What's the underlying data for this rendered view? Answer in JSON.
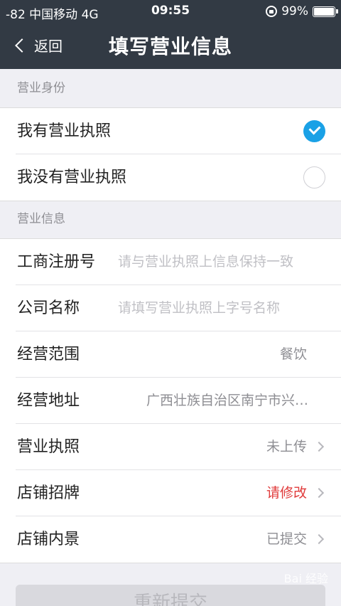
{
  "status_bar": {
    "carrier": "-82 中国移动  4G",
    "time": "09:55",
    "battery": "99%"
  },
  "nav": {
    "back_label": "返回",
    "title": "填写营业信息"
  },
  "identity_section": {
    "header": "营业身份",
    "options": [
      {
        "label": "我有营业执照",
        "selected": true
      },
      {
        "label": "我没有营业执照",
        "selected": false
      }
    ]
  },
  "info_section": {
    "header": "营业信息",
    "rows": [
      {
        "label": "工商注册号",
        "placeholder": "请与营业执照上信息保持一致"
      },
      {
        "label": "公司名称",
        "placeholder": "请填写营业执照上字号名称"
      },
      {
        "label": "经营范围",
        "value": "餐饮"
      },
      {
        "label": "经营地址",
        "value": "广西壮族自治区南宁市兴…"
      },
      {
        "label": "营业执照",
        "value": "未上传"
      },
      {
        "label": "店铺招牌",
        "value": "请修改"
      },
      {
        "label": "店铺内景",
        "value": "已提交"
      }
    ]
  },
  "submit_label": "重新提交",
  "watermark": "Bai 经验",
  "colors": {
    "header_bg": "#323a44",
    "accent": "#1aa1e6",
    "warning": "#e03a3a"
  }
}
